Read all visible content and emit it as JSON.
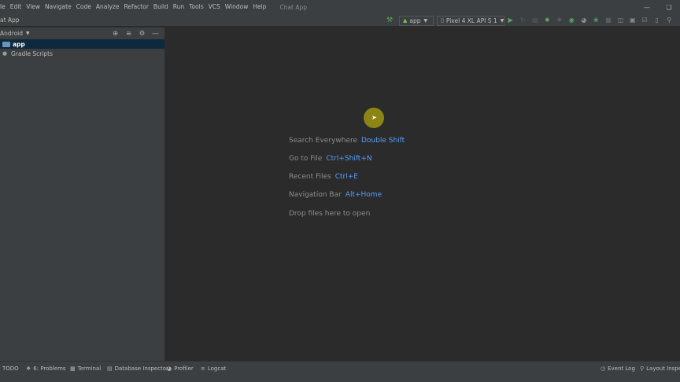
{
  "menu": {
    "items": [
      "le",
      "Edit",
      "View",
      "Navigate",
      "Code",
      "Analyze",
      "Refactor",
      "Build",
      "Run",
      "Tools",
      "VCS",
      "Window",
      "Help"
    ],
    "window_title": "Chat App"
  },
  "toolbar": {
    "breadcrumb": "at App",
    "run_config": "app",
    "device": "Pixel 4 XL API S 1"
  },
  "project_panel": {
    "view_mode": "Android",
    "tree": [
      {
        "label": "app",
        "selected": true
      },
      {
        "label": "Gradle Scripts",
        "selected": false
      }
    ]
  },
  "editor_hints": [
    {
      "text": "Search Everywhere",
      "key": "Double Shift"
    },
    {
      "text": "Go to File",
      "key": "Ctrl+Shift+N"
    },
    {
      "text": "Recent Files",
      "key": "Ctrl+E"
    },
    {
      "text": "Navigation Bar",
      "key": "Alt+Home"
    },
    {
      "text": "Drop files here to open",
      "key": ""
    }
  ],
  "status_bar": {
    "left": [
      {
        "label": "TODO",
        "icon": "list-icon"
      },
      {
        "label": "6: Problems",
        "icon": "info-icon"
      },
      {
        "label": "Terminal",
        "icon": "terminal-icon"
      },
      {
        "label": "Database Inspector",
        "icon": "database-icon"
      },
      {
        "label": "Profiler",
        "icon": "profiler-icon"
      },
      {
        "label": "Logcat",
        "icon": "logcat-icon"
      }
    ],
    "right": [
      {
        "label": "Event Log",
        "icon": "event-log-icon"
      },
      {
        "label": "Layout Inspec",
        "icon": "layout-inspector-icon"
      }
    ]
  },
  "colors": {
    "background": "#2b2b2b",
    "panel": "#3c3f41",
    "selection": "#0d293e",
    "shortcut": "#589df6",
    "cursor_highlight": "#8c8514"
  }
}
